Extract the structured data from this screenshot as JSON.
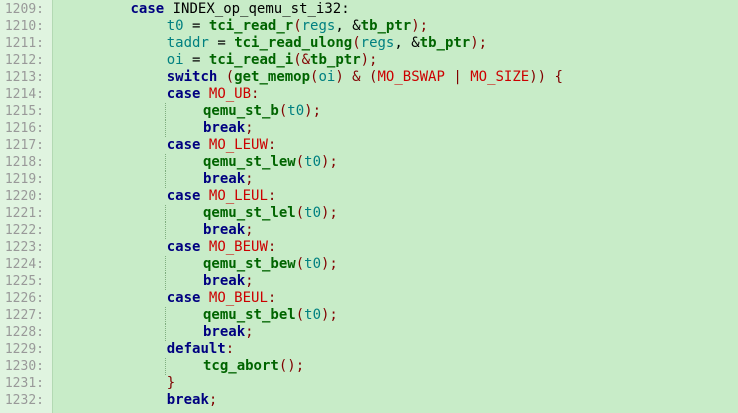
{
  "colors": {
    "background": "#c8ecc8",
    "gutter": "#e0f4e0",
    "keyword": "#000080",
    "function": "#006400",
    "macro": "#cc0000",
    "variable": "#008080",
    "operator": "#800000"
  },
  "lines": [
    {
      "n": "1209:",
      "indent": 2,
      "tokens": [
        {
          "t": "case",
          "c": "kw"
        },
        {
          "t": " INDEX_op_qemu_st_i32:",
          "c": "pl"
        }
      ]
    },
    {
      "n": "1210:",
      "indent": 3,
      "tokens": [
        {
          "t": "t0",
          "c": "var"
        },
        {
          "t": " = ",
          "c": "pl"
        },
        {
          "t": "tci_read_r",
          "c": "fn"
        },
        {
          "t": "(",
          "c": "op"
        },
        {
          "t": "regs",
          "c": "var"
        },
        {
          "t": ", &",
          "c": "pl"
        },
        {
          "t": "tb_ptr",
          "c": "nm"
        },
        {
          "t": ");",
          "c": "op"
        }
      ]
    },
    {
      "n": "1211:",
      "indent": 3,
      "tokens": [
        {
          "t": "taddr",
          "c": "var"
        },
        {
          "t": " = ",
          "c": "pl"
        },
        {
          "t": "tci_read_ulong",
          "c": "fn"
        },
        {
          "t": "(",
          "c": "op"
        },
        {
          "t": "regs",
          "c": "var"
        },
        {
          "t": ", &",
          "c": "pl"
        },
        {
          "t": "tb_ptr",
          "c": "nm"
        },
        {
          "t": ");",
          "c": "op"
        }
      ]
    },
    {
      "n": "1212:",
      "indent": 3,
      "tokens": [
        {
          "t": "oi",
          "c": "var"
        },
        {
          "t": " = ",
          "c": "pl"
        },
        {
          "t": "tci_read_i",
          "c": "fn"
        },
        {
          "t": "(&",
          "c": "op"
        },
        {
          "t": "tb_ptr",
          "c": "nm"
        },
        {
          "t": ");",
          "c": "op"
        }
      ]
    },
    {
      "n": "1213:",
      "indent": 3,
      "tokens": [
        {
          "t": "switch",
          "c": "kw"
        },
        {
          "t": " (",
          "c": "op"
        },
        {
          "t": "get_memop",
          "c": "fn"
        },
        {
          "t": "(",
          "c": "op"
        },
        {
          "t": "oi",
          "c": "var"
        },
        {
          "t": ") & (",
          "c": "op"
        },
        {
          "t": "MO_BSWAP",
          "c": "mac"
        },
        {
          "t": " | ",
          "c": "op"
        },
        {
          "t": "MO_SIZE",
          "c": "mac"
        },
        {
          "t": ")) {",
          "c": "op"
        }
      ]
    },
    {
      "n": "1214:",
      "indent": 3,
      "tokens": [
        {
          "t": "case",
          "c": "kw"
        },
        {
          "t": " ",
          "c": "pl"
        },
        {
          "t": "MO_UB",
          "c": "mac"
        },
        {
          "t": ":",
          "c": "op"
        }
      ]
    },
    {
      "n": "1215:",
      "indent": 4,
      "tokens": [
        {
          "t": "qemu_st_b",
          "c": "fn"
        },
        {
          "t": "(",
          "c": "op"
        },
        {
          "t": "t0",
          "c": "var"
        },
        {
          "t": ");",
          "c": "op"
        }
      ]
    },
    {
      "n": "1216:",
      "indent": 4,
      "tokens": [
        {
          "t": "break",
          "c": "kw"
        },
        {
          "t": ";",
          "c": "op"
        }
      ]
    },
    {
      "n": "1217:",
      "indent": 3,
      "tokens": [
        {
          "t": "case",
          "c": "kw"
        },
        {
          "t": " ",
          "c": "pl"
        },
        {
          "t": "MO_LEUW",
          "c": "mac"
        },
        {
          "t": ":",
          "c": "op"
        }
      ]
    },
    {
      "n": "1218:",
      "indent": 4,
      "tokens": [
        {
          "t": "qemu_st_lew",
          "c": "fn"
        },
        {
          "t": "(",
          "c": "op"
        },
        {
          "t": "t0",
          "c": "var"
        },
        {
          "t": ");",
          "c": "op"
        }
      ]
    },
    {
      "n": "1219:",
      "indent": 4,
      "tokens": [
        {
          "t": "break",
          "c": "kw"
        },
        {
          "t": ";",
          "c": "op"
        }
      ]
    },
    {
      "n": "1220:",
      "indent": 3,
      "tokens": [
        {
          "t": "case",
          "c": "kw"
        },
        {
          "t": " ",
          "c": "pl"
        },
        {
          "t": "MO_LEUL",
          "c": "mac"
        },
        {
          "t": ":",
          "c": "op"
        }
      ]
    },
    {
      "n": "1221:",
      "indent": 4,
      "tokens": [
        {
          "t": "qemu_st_lel",
          "c": "fn"
        },
        {
          "t": "(",
          "c": "op"
        },
        {
          "t": "t0",
          "c": "var"
        },
        {
          "t": ");",
          "c": "op"
        }
      ]
    },
    {
      "n": "1222:",
      "indent": 4,
      "tokens": [
        {
          "t": "break",
          "c": "kw"
        },
        {
          "t": ";",
          "c": "op"
        }
      ]
    },
    {
      "n": "1223:",
      "indent": 3,
      "tokens": [
        {
          "t": "case",
          "c": "kw"
        },
        {
          "t": " ",
          "c": "pl"
        },
        {
          "t": "MO_BEUW",
          "c": "mac"
        },
        {
          "t": ":",
          "c": "op"
        }
      ]
    },
    {
      "n": "1224:",
      "indent": 4,
      "tokens": [
        {
          "t": "qemu_st_bew",
          "c": "fn"
        },
        {
          "t": "(",
          "c": "op"
        },
        {
          "t": "t0",
          "c": "var"
        },
        {
          "t": ");",
          "c": "op"
        }
      ]
    },
    {
      "n": "1225:",
      "indent": 4,
      "tokens": [
        {
          "t": "break",
          "c": "kw"
        },
        {
          "t": ";",
          "c": "op"
        }
      ]
    },
    {
      "n": "1226:",
      "indent": 3,
      "tokens": [
        {
          "t": "case",
          "c": "kw"
        },
        {
          "t": " ",
          "c": "pl"
        },
        {
          "t": "MO_BEUL",
          "c": "mac"
        },
        {
          "t": ":",
          "c": "op"
        }
      ]
    },
    {
      "n": "1227:",
      "indent": 4,
      "tokens": [
        {
          "t": "qemu_st_bel",
          "c": "fn"
        },
        {
          "t": "(",
          "c": "op"
        },
        {
          "t": "t0",
          "c": "var"
        },
        {
          "t": ");",
          "c": "op"
        }
      ]
    },
    {
      "n": "1228:",
      "indent": 4,
      "tokens": [
        {
          "t": "break",
          "c": "kw"
        },
        {
          "t": ";",
          "c": "op"
        }
      ]
    },
    {
      "n": "1229:",
      "indent": 3,
      "tokens": [
        {
          "t": "default",
          "c": "kw"
        },
        {
          "t": ":",
          "c": "op"
        }
      ]
    },
    {
      "n": "1230:",
      "indent": 4,
      "tokens": [
        {
          "t": "tcg_abort",
          "c": "fn"
        },
        {
          "t": "();",
          "c": "op"
        }
      ]
    },
    {
      "n": "1231:",
      "indent": 3,
      "tokens": [
        {
          "t": "}",
          "c": "op"
        }
      ]
    },
    {
      "n": "1232:",
      "indent": 3,
      "tokens": [
        {
          "t": "break",
          "c": "kw"
        },
        {
          "t": ";",
          "c": "op"
        }
      ]
    }
  ]
}
